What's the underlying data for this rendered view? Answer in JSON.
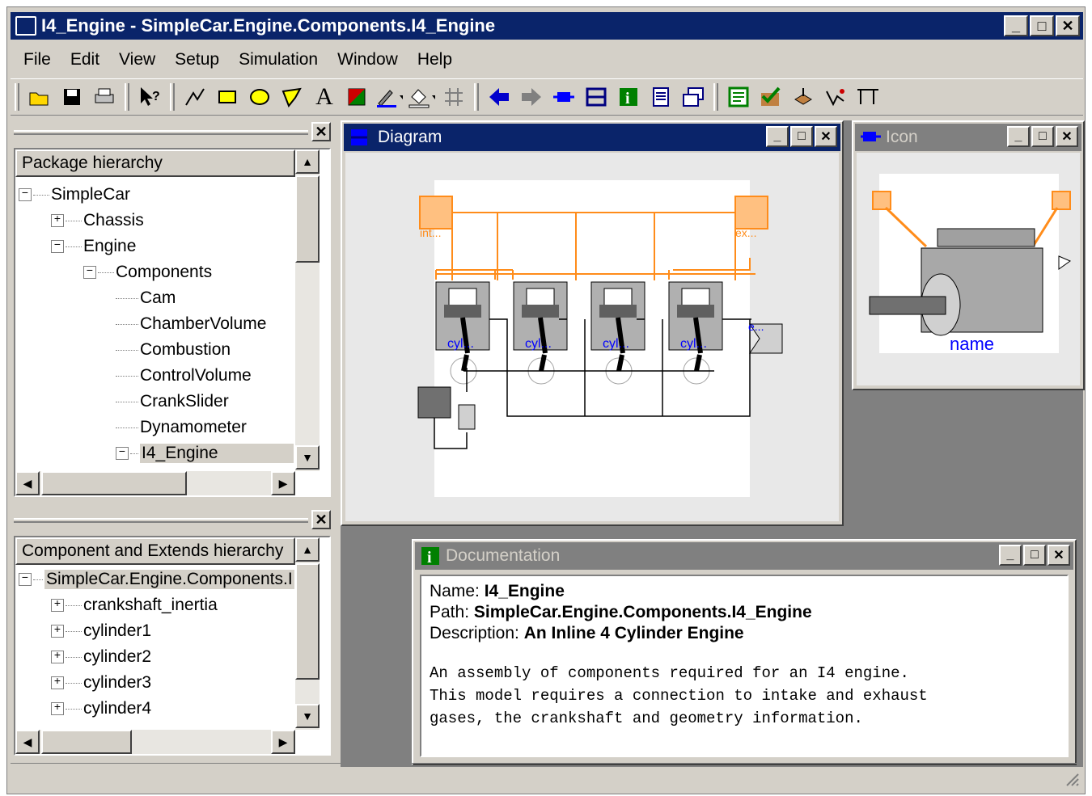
{
  "window": {
    "title": "I4_Engine - SimpleCar.Engine.Components.I4_Engine",
    "min": "_",
    "max": "□",
    "close": "✕"
  },
  "menu": [
    "File",
    "Edit",
    "View",
    "Setup",
    "Simulation",
    "Window",
    "Help"
  ],
  "toolbar": {
    "icons": [
      "open",
      "save",
      "print",
      "help",
      "line",
      "rectangle",
      "ellipse",
      "polygon",
      "text",
      "bitmap",
      "line-color",
      "fill-color",
      "grid",
      "back",
      "forward",
      "component",
      "diagram",
      "info",
      "text-view",
      "duplicate",
      "check",
      "validate",
      "translate",
      "plot",
      "compare"
    ],
    "text_tool": "A"
  },
  "package_panel": {
    "header": "Package hierarchy",
    "close": "✕",
    "items": [
      {
        "label": "SimpleCar",
        "level": 0,
        "toggle": "−"
      },
      {
        "label": "Chassis",
        "level": 1,
        "toggle": "+"
      },
      {
        "label": "Engine",
        "level": 1,
        "toggle": "−"
      },
      {
        "label": "Components",
        "level": 2,
        "toggle": "−"
      },
      {
        "label": "Cam",
        "level": 3,
        "toggle": ""
      },
      {
        "label": "ChamberVolume",
        "level": 3,
        "toggle": ""
      },
      {
        "label": "Combustion",
        "level": 3,
        "toggle": ""
      },
      {
        "label": "ControlVolume",
        "level": 3,
        "toggle": ""
      },
      {
        "label": "CrankSlider",
        "level": 3,
        "toggle": ""
      },
      {
        "label": "Dynamometer",
        "level": 3,
        "toggle": ""
      },
      {
        "label": "I4_Engine",
        "level": 3,
        "toggle": "−",
        "selected": true
      }
    ]
  },
  "component_panel": {
    "header": "Component and Extends hierarchy",
    "close": "✕",
    "items": [
      {
        "label": "SimpleCar.Engine.Components.I",
        "level": 0,
        "toggle": "−",
        "selected": true
      },
      {
        "label": "crankshaft_inertia",
        "level": 1,
        "toggle": "+"
      },
      {
        "label": "cylinder1",
        "level": 1,
        "toggle": "+"
      },
      {
        "label": "cylinder2",
        "level": 1,
        "toggle": "+"
      },
      {
        "label": "cylinder3",
        "level": 1,
        "toggle": "+"
      },
      {
        "label": "cylinder4",
        "level": 1,
        "toggle": "+"
      }
    ]
  },
  "diagram": {
    "title": "Diagram",
    "intake_label": "int...",
    "exhaust_label": "ex...",
    "cyl_label": "cyl...",
    "flange_label": "e...",
    "colors": {
      "port": "#ff8c1a",
      "port_fill": "#ffc080",
      "wire": "#ff8c1a",
      "cyl_label": "#0000ff"
    }
  },
  "icon_win": {
    "title": "Icon",
    "name_label": "name"
  },
  "documentation": {
    "title": "Documentation",
    "name_key": "Name:",
    "name_val": "I4_Engine",
    "path_key": "Path:",
    "path_val": "SimpleCar.Engine.Components.I4_Engine",
    "desc_key": "Description:",
    "desc_val": "An Inline 4 Cylinder Engine",
    "body": [
      "An assembly of components required for an I4 engine.",
      "This model requires a connection to intake and exhaust",
      "gases, the crankshaft and geometry information."
    ]
  },
  "scroll": {
    "up": "▲",
    "down": "▼",
    "left": "◀",
    "right": "▶"
  }
}
